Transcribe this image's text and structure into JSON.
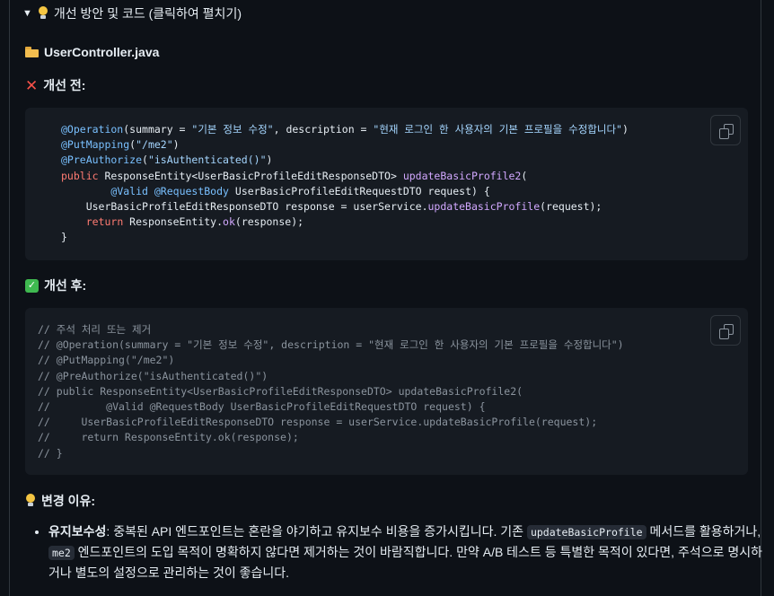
{
  "details": {
    "summary_label": "개선 방안 및 코드 (클릭하여 펼치기)"
  },
  "file": {
    "name": "UserController.java"
  },
  "before": {
    "heading": "개선 전:",
    "code_lines": [
      [
        [
          "ann",
          "@Operation"
        ],
        [
          "pl",
          "(summary = "
        ],
        [
          "str",
          "\"기본 정보 수정\""
        ],
        [
          "pl",
          ", description = "
        ],
        [
          "str",
          "\"현재 로그인 한 사용자의 기본 프로필을 수정합니다\""
        ],
        [
          "pl",
          ")"
        ]
      ],
      [
        [
          "ann",
          "@PutMapping"
        ],
        [
          "pl",
          "("
        ],
        [
          "str",
          "\"/me2\""
        ],
        [
          "pl",
          ")"
        ]
      ],
      [
        [
          "ann",
          "@PreAuthorize"
        ],
        [
          "pl",
          "("
        ],
        [
          "str",
          "\"isAuthenticated()\""
        ],
        [
          "pl",
          ")"
        ]
      ],
      [
        [
          "kw",
          "public"
        ],
        [
          "pl",
          " ResponseEntity<UserBasicProfileEditResponseDTO> "
        ],
        [
          "fn",
          "updateBasicProfile2"
        ],
        [
          "pl",
          "("
        ]
      ],
      [
        [
          "pl",
          "        "
        ],
        [
          "ann",
          "@Valid"
        ],
        [
          "pl",
          " "
        ],
        [
          "ann",
          "@RequestBody"
        ],
        [
          "pl",
          " UserBasicProfileEditRequestDTO request) {"
        ]
      ],
      [
        [
          "pl",
          "    UserBasicProfileEditResponseDTO response = userService."
        ],
        [
          "fn",
          "updateBasicProfile"
        ],
        [
          "pl",
          "(request);"
        ]
      ],
      [
        [
          "pl",
          "    "
        ],
        [
          "kw",
          "return"
        ],
        [
          "pl",
          " ResponseEntity."
        ],
        [
          "fn",
          "ok"
        ],
        [
          "pl",
          "(response);"
        ]
      ],
      [
        [
          "pl",
          "}"
        ]
      ]
    ]
  },
  "after": {
    "heading": "개선 후:",
    "code_lines": [
      "// 주석 처리 또는 제거",
      "// @Operation(summary = \"기본 정보 수정\", description = \"현재 로그인 한 사용자의 기본 프로필을 수정합니다\")",
      "// @PutMapping(\"/me2\")",
      "// @PreAuthorize(\"isAuthenticated()\")",
      "// public ResponseEntity<UserBasicProfileEditResponseDTO> updateBasicProfile2(",
      "//         @Valid @RequestBody UserBasicProfileEditRequestDTO request) {",
      "//     UserBasicProfileEditResponseDTO response = userService.updateBasicProfile(request);",
      "//     return ResponseEntity.ok(response);",
      "// }"
    ]
  },
  "reason": {
    "heading": "변경 이유:",
    "item": {
      "label": "유지보수성",
      "colon": ": ",
      "text1": "중복된 API 엔드포인트는 혼란을 야기하고 유지보수 비용을 증가시킵니다. 기존 ",
      "code1": "updateBasicProfile",
      "text2": " 메서드를 활용하거나, ",
      "code2": "me2",
      "text3": " 엔드포인트의 도입 목적이 명확하지 않다면 제거하는 것이 바람직합니다. 만약 A/B 테스트 등 특별한 목적이 있다면, 주석으로 명시하거나 별도의 설정으로 관리하는 것이 좋습니다."
    }
  },
  "colors": {
    "background": "#0d1117",
    "code_bg": "#161b22",
    "annotation": "#79c0ff",
    "keyword": "#ff7b72",
    "string": "#a5d6ff",
    "function": "#d2a8ff",
    "comment": "#8b949e"
  }
}
